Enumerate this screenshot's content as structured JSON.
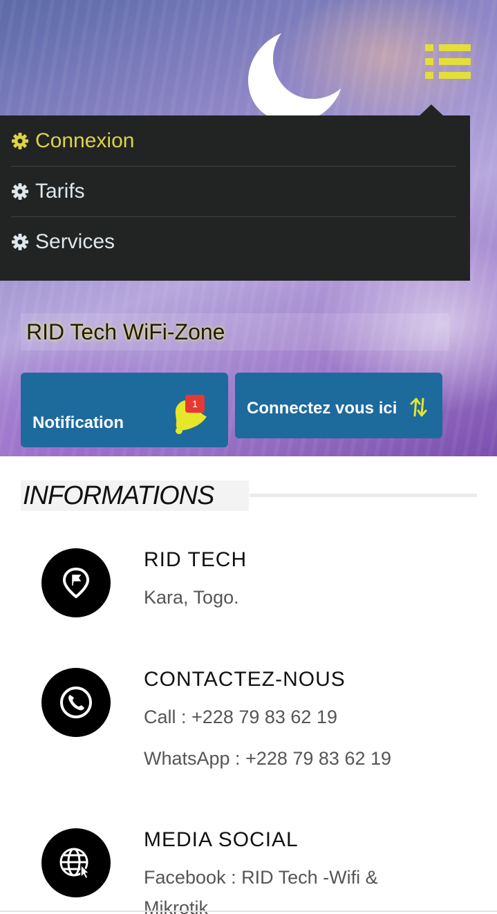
{
  "menu": {
    "items": [
      {
        "label": "Connexion",
        "active": true
      },
      {
        "label": "Tarifs",
        "active": false
      },
      {
        "label": "Services",
        "active": false
      }
    ]
  },
  "hero": {
    "title": "RID Tech WiFi-Zone",
    "notification_label": "Notification",
    "notification_count": "1",
    "connect_label": "Connectez vous ici"
  },
  "info": {
    "heading": "INFORMATIONS",
    "company": {
      "title": "RID TECH",
      "address": "Kara, Togo."
    },
    "contact": {
      "title": "CONTACTEZ-NOUS",
      "call": "Call : +228 79 83 62 19",
      "whatsapp": "WhatsApp : +228 79 83 62 19"
    },
    "social": {
      "title": "MEDIA SOCIAL",
      "facebook_prefix": "Facebook : ",
      "facebook_link": "RID Tech -Wifi &",
      "facebook_link_cont": "Mikrotik"
    }
  },
  "colors": {
    "accent_yellow": "#ddd34a",
    "menu_bg": "#222423",
    "button_blue": "#1d6a9d",
    "badge_red": "#e53935"
  },
  "icons": [
    "moon-logo-icon",
    "menu-list-icon",
    "gear-icon",
    "bell-icon",
    "swap-arrows-icon",
    "map-pin-flag-icon",
    "phone-icon",
    "globe-cursor-icon"
  ]
}
